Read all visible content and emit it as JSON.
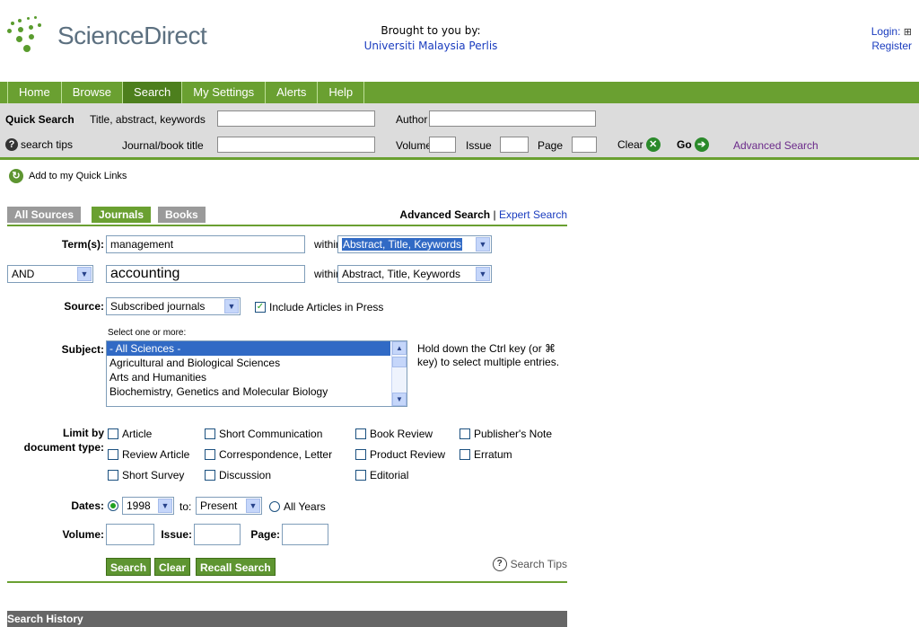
{
  "header": {
    "logo_text": "ScienceDirect",
    "brought_label": "Brought to you by:",
    "institution": "Universiti Malaysia Perlis",
    "login_label": "Login:",
    "login_icon": "⊞",
    "register_label": "Register"
  },
  "nav": {
    "items": [
      {
        "label": "Home"
      },
      {
        "label": "Browse"
      },
      {
        "label": "Search"
      },
      {
        "label": "My Settings"
      },
      {
        "label": "Alerts"
      },
      {
        "label": "Help"
      }
    ]
  },
  "quick_search": {
    "title": "Quick Search",
    "title_abstract_label": "Title, abstract, keywords",
    "title_abstract_value": "",
    "author_label": "Author",
    "author_value": "",
    "search_tips_label": "search tips",
    "journal_label": "Journal/book title",
    "journal_value": "",
    "volume_label": "Volume",
    "issue_label": "Issue",
    "page_label": "Page",
    "clear_label": "Clear",
    "go_label": "Go",
    "advanced_label": "Advanced Search"
  },
  "quick_links": {
    "label": "Add to my Quick Links"
  },
  "tabs": {
    "all_sources": "All Sources",
    "journals": "Journals",
    "books": "Books",
    "advanced_search": "Advanced Search",
    "separator": "|",
    "expert_search": "Expert Search"
  },
  "form": {
    "terms_label": "Term(s):",
    "term1_value": "management",
    "within_label": "within:",
    "within1_value": "Abstract, Title, Keywords",
    "operator_value": "AND",
    "term2_value": "accounting",
    "within2_value": "Abstract, Title, Keywords",
    "source_label": "Source:",
    "source_value": "Subscribed journals",
    "include_press_label": "Include Articles in Press",
    "select_hint": "Select one or more:",
    "subject_label": "Subject:",
    "subjects": [
      "- All Sciences -",
      "Agricultural and Biological Sciences",
      "Arts and Humanities",
      "Biochemistry, Genetics and Molecular Biology"
    ],
    "ctrl_hint": "Hold down the Ctrl key (or ⌘ key) to select multiple entries.",
    "limit_label_1": "Limit by",
    "limit_label_2": "document type:",
    "doc_types": [
      "Article",
      "Short Communication",
      "Book Review",
      "Publisher's Note",
      "Review Article",
      "Correspondence, Letter",
      "Product Review",
      "Erratum",
      "Short Survey",
      "Discussion",
      "Editorial"
    ],
    "dates_label": "Dates:",
    "date_from": "1998",
    "to_label": "to:",
    "date_to": "Present",
    "all_years_label": "All Years",
    "volume_label": "Volume:",
    "issue_label": "Issue:",
    "page_label": "Page:",
    "search_button": "Search",
    "clear_button": "Clear",
    "recall_button": "Recall Search",
    "search_tips": "Search Tips"
  },
  "history": {
    "title": "Search History"
  },
  "colors": {
    "brand_green": "#6aa031",
    "link_blue": "#1a3cbf",
    "selected_blue": "#316ac5"
  }
}
